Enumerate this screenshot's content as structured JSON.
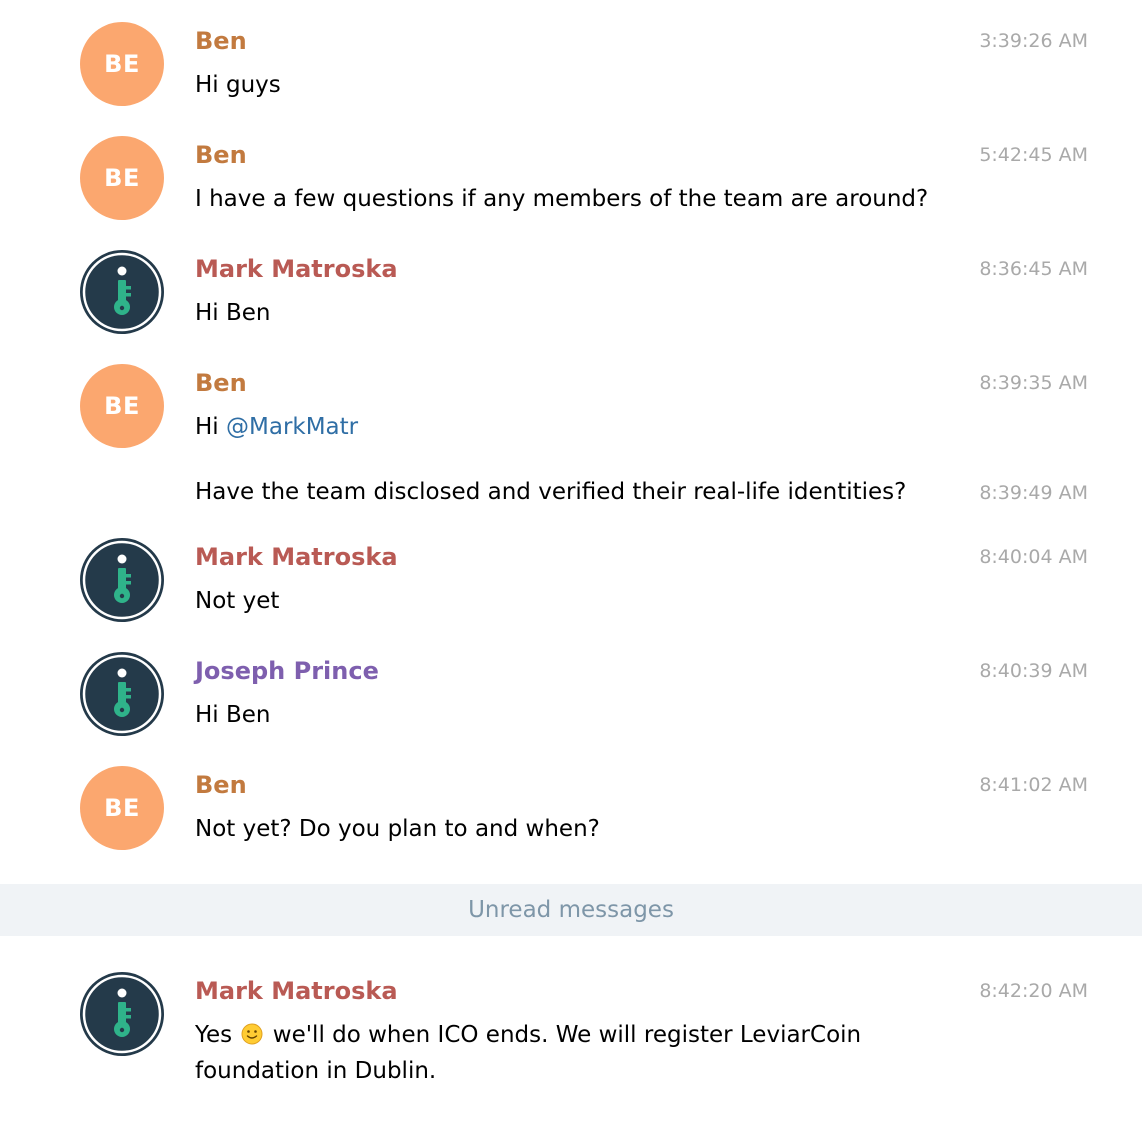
{
  "colors": {
    "ben": "#c27a3f",
    "mark": "#b95a54",
    "joseph": "#7e5fae",
    "avatar_initials_bg": "#fba76f",
    "key_avatar_bg": "#243a4a",
    "key_icon": "#2fb38a",
    "timestamp": "#a9a9a9",
    "mention": "#2f6ea5",
    "unread_bar_bg": "#f0f3f6"
  },
  "messages": [
    {
      "name": "Ben",
      "initials": "BE",
      "text": "Hi guys",
      "time": "3:39:26 AM"
    },
    {
      "name": "Ben",
      "initials": "BE",
      "text": "I have a few questions if any members of the team are around?",
      "time": "5:42:45 AM"
    },
    {
      "name": "Mark Matroska",
      "avatar_icon": "key-icon",
      "text": "Hi Ben",
      "time": "8:36:45 AM"
    },
    {
      "name": "Ben",
      "initials": "BE",
      "text_prefix": "Hi ",
      "mention": "@MarkMatr",
      "time": "8:39:35 AM"
    },
    {
      "text": "Have the team disclosed and verified their real-life identities?",
      "time": "8:39:49 AM"
    },
    {
      "name": "Mark Matroska",
      "avatar_icon": "key-icon",
      "text": "Not yet",
      "time": "8:40:04 AM"
    },
    {
      "name": "Joseph Prince",
      "avatar_icon": "key-icon",
      "text": "Hi Ben",
      "time": "8:40:39 AM"
    },
    {
      "name": "Ben",
      "initials": "BE",
      "text": "Not yet? Do you plan to and when?",
      "time": "8:41:02 AM"
    },
    {
      "name": "Mark Matroska",
      "avatar_icon": "key-icon",
      "text_prefix": "Yes",
      "emoji": "slightly-smiling-face-icon",
      "text_suffix": "we'll do when ICO ends. We will register LeviarCoin foundation in Dublin.",
      "time": "8:42:20 AM"
    }
  ],
  "unread_divider": {
    "label": "Unread messages"
  }
}
